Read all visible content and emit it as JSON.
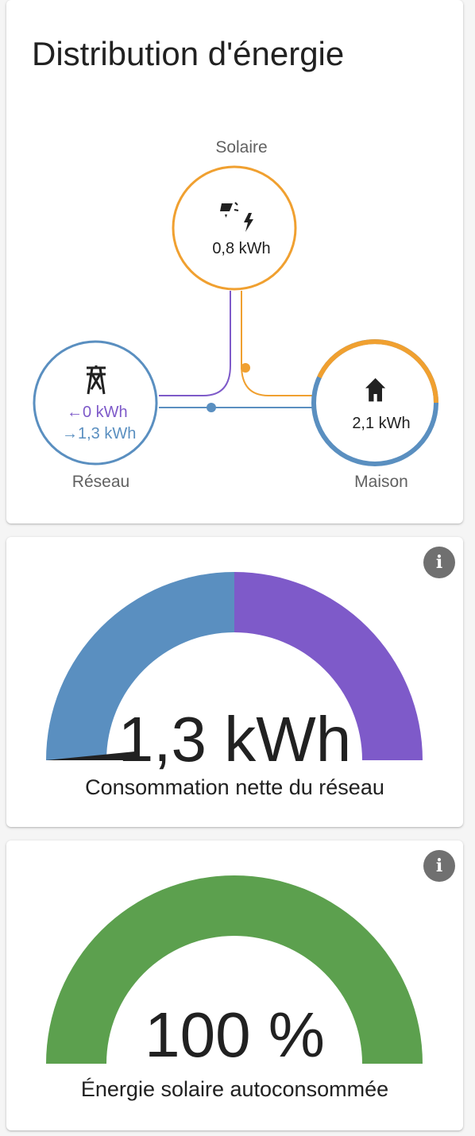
{
  "distribution": {
    "title": "Distribution d'énergie",
    "solar": {
      "label": "Solaire",
      "value": "0,8 kWh",
      "icon": "solar-power-icon",
      "color": "#f0a030"
    },
    "grid": {
      "label": "Réseau",
      "to_grid": "0 kWh",
      "from_grid": "1,3 kWh",
      "icon": "transmission-tower-icon",
      "color": "#5a8fc0",
      "return_color": "#7e5ac9"
    },
    "home": {
      "label": "Maison",
      "value": "2,1 kWh",
      "icon": "home-icon",
      "solar_share": 0.38
    }
  },
  "grid_gauge": {
    "value": "1,3 kWh",
    "name": "Consommation nette du réseau",
    "left_color": "#5a8fc0",
    "right_color": "#7e5ac9",
    "info_icon": "info-icon"
  },
  "solar_gauge": {
    "value": "100 %",
    "name": "Énergie solaire autoconsommée",
    "fill_color": "#5ca04e",
    "percent": 100,
    "info_icon": "info-icon"
  }
}
